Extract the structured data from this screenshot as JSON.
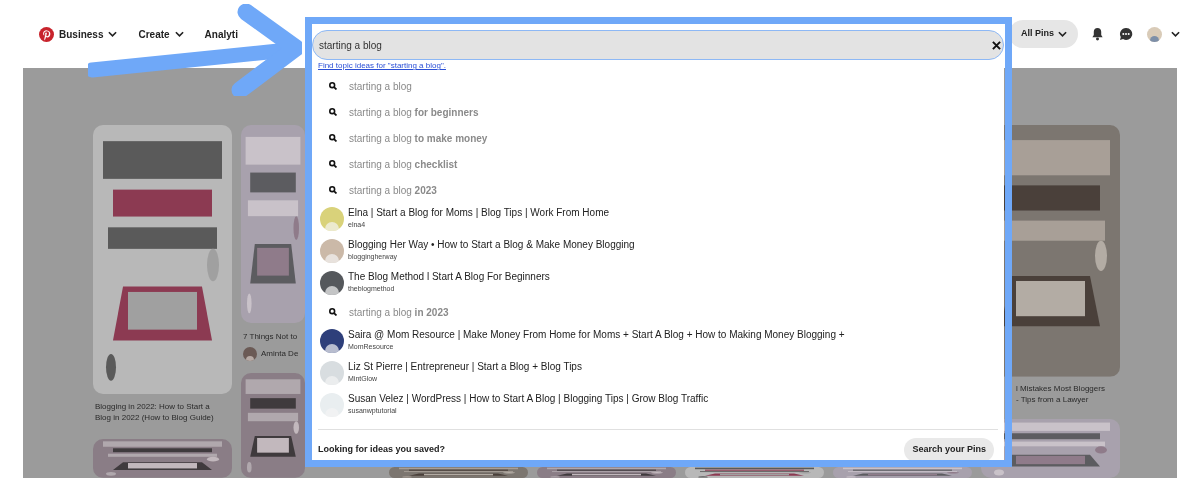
{
  "header": {
    "nav": [
      {
        "label": "Business"
      },
      {
        "label": "Create"
      },
      {
        "label": "Analyti"
      }
    ],
    "filter": "All Pins"
  },
  "search": {
    "value": "starting a blog",
    "topic_link": "Find topic ideas for \"starting a blog\"."
  },
  "suggestions": [
    {
      "kind": "query",
      "text": "starting a blog"
    },
    {
      "kind": "query",
      "text": "starting a blog **for beginners**"
    },
    {
      "kind": "query",
      "text": "starting a blog **to make money**"
    },
    {
      "kind": "query",
      "text": "starting a blog **checklist**"
    },
    {
      "kind": "query",
      "text": "starting a blog **2023**"
    },
    {
      "kind": "profile",
      "name": "Elna | Start a Blog for Moms | Blog Tips | Work From Home",
      "handle": "elna4",
      "color": "#d9d27a"
    },
    {
      "kind": "profile",
      "name": "Blogging Her Way • How to Start a Blog & Make Money Blogging",
      "handle": "bloggingherway",
      "color": "#cbb9a8"
    },
    {
      "kind": "profile",
      "name": "The Blog Method l Start A Blog For Beginners",
      "handle": "theblogmethod",
      "color": "#55585c"
    },
    {
      "kind": "query",
      "text": "starting a blog **in 2023**"
    },
    {
      "kind": "profile",
      "name": "Saira @ Mom Resource | Make Money From Home for Moms + Start A Blog + How to Making Money Blogging +",
      "handle": "MomResource",
      "color": "#2e3f7a"
    },
    {
      "kind": "profile",
      "name": "Liz St Pierre | Entrepreneur | Start a Blog + Blog Tips",
      "handle": "MintGlow",
      "color": "#d8dde0"
    },
    {
      "kind": "profile",
      "name": "Susan Velez | WordPress | How to Start A Blog | Blogging Tips | Grow Blog Traffic",
      "handle": "susanwptutorial",
      "color": "#e9eef0"
    }
  ],
  "footer": {
    "prompt": "Looking for ideas you saved?",
    "button": "Search your Pins"
  },
  "pins": [
    {
      "caption_lines": [
        "Blogging in 2022: How to Start a",
        "Blog in 2022 (How to Blog Guide)"
      ]
    },
    {
      "caption_lines": [
        "7 Things Not to"
      ],
      "author": "Aminta De"
    },
    {
      "caption_lines": [
        "l Mistakes Most Bloggers",
        "- Tips from a Lawyer"
      ]
    }
  ]
}
